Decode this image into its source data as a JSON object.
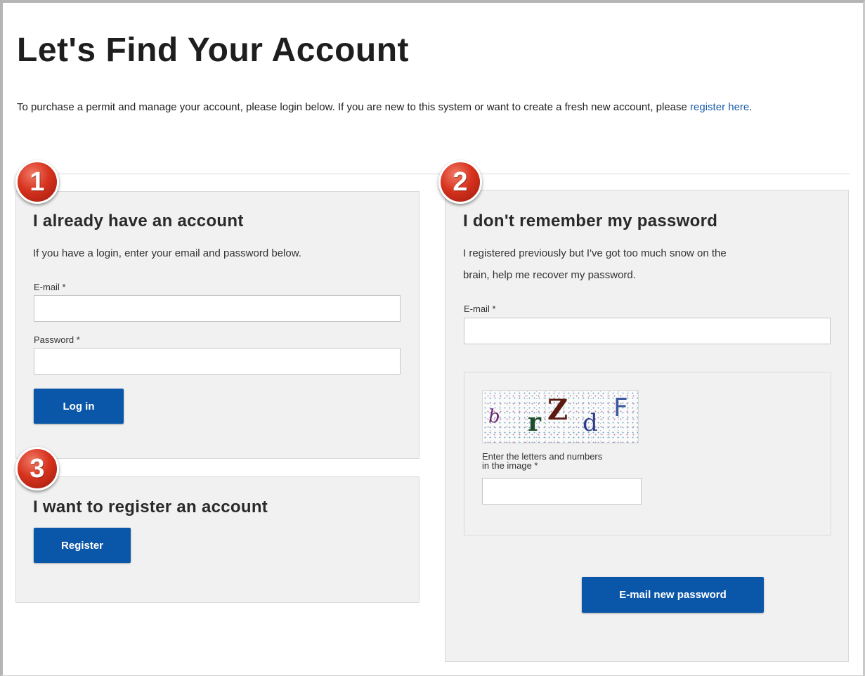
{
  "page": {
    "title": "Let's Find Your Account",
    "intro_text": "To purchase a permit and manage your account, please login below. If you are new to this system or want to create a fresh new account, please ",
    "intro_link": "register here",
    "intro_end": "."
  },
  "login": {
    "step": "1",
    "heading": "I already have an account",
    "description": "If you have a login, enter your email and password below.",
    "email_label": "E-mail *",
    "email_value": "",
    "password_label": "Password *",
    "password_value": "",
    "submit_label": "Log in"
  },
  "register": {
    "step": "3",
    "heading": "I want to register an account",
    "button_label": "Register"
  },
  "forgot": {
    "step": "2",
    "heading": "I don't remember my password",
    "description_line1": "I registered previously but I've got too much snow on the",
    "description_line2": "brain, help me recover my password.",
    "email_label": "E-mail *",
    "email_value": "",
    "captcha_chars": [
      "b",
      "r",
      "Z",
      "d",
      "F"
    ],
    "captcha_caption_line1": "Enter the letters and numbers",
    "captcha_caption_line2": "in the image *",
    "captcha_value": "",
    "submit_label": "E-mail new password"
  },
  "colors": {
    "button": "#0a56a8",
    "link": "#1a5ea8",
    "panel_bg": "#f1f1f1",
    "badge": "#d7331f"
  }
}
